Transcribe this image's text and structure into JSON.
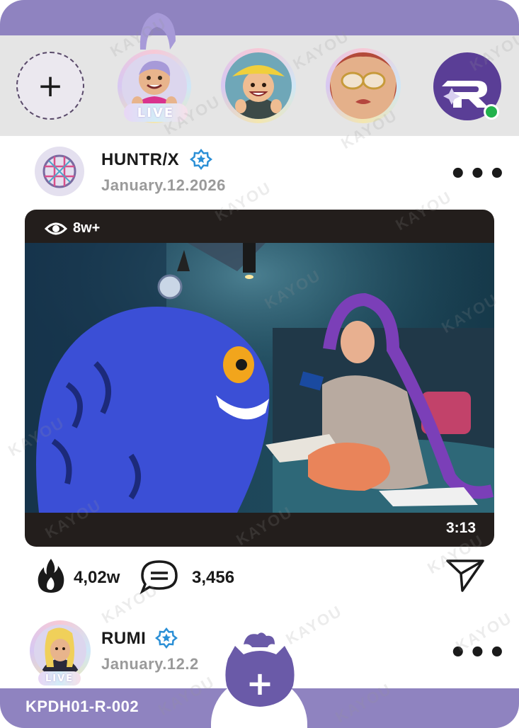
{
  "stories": {
    "add_label": "+",
    "live_label": "LIVE"
  },
  "post1": {
    "username": "HUNTR/X",
    "date": "January.12.2026",
    "more": "•••",
    "views": "8w+",
    "duration": "3:13",
    "likes": "4,02w",
    "comments": "3,456"
  },
  "post2": {
    "username": "RUMI",
    "date": "January.12.2",
    "more": "•••",
    "live_label": "LIVE"
  },
  "footer": {
    "card_code": "KPDH01-R-002",
    "add_label": "+"
  },
  "watermark": "KAYOU",
  "colors": {
    "brand_purple": "#8f83c0",
    "verified_blue": "#2a8fd6",
    "online_green": "#22b24c",
    "story_bg": "#e5e5e5"
  },
  "icons": [
    "plus-icon",
    "verified-badge-icon",
    "more-icon",
    "eye-icon",
    "fire-icon",
    "comment-icon",
    "send-icon",
    "tiger-mascot-icon"
  ]
}
